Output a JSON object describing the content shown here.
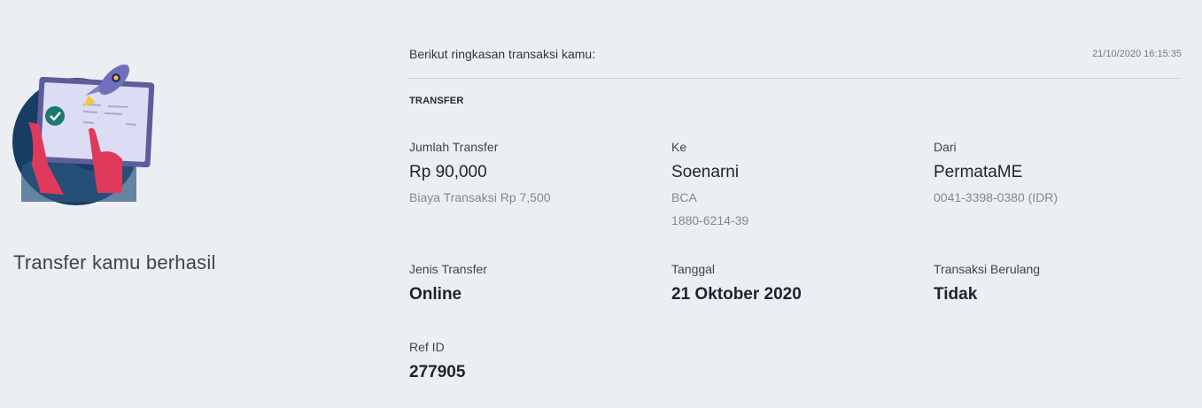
{
  "status": {
    "title": "Transfer kamu berhasil"
  },
  "summary": {
    "intro": "Berikut ringkasan transaksi kamu:",
    "timestamp": "21/10/2020 16:15:35"
  },
  "section": {
    "label": "TRANSFER"
  },
  "fields": {
    "amount": {
      "label": "Jumlah Transfer",
      "value": "Rp 90,000",
      "fee": "Biaya Transaksi Rp 7,500"
    },
    "to": {
      "label": "Ke",
      "value": "Soenarni",
      "bank": "BCA",
      "account": "1880-6214-39"
    },
    "from": {
      "label": "Dari",
      "value": "PermataME",
      "account": "0041-3398-0380 (IDR)"
    },
    "type": {
      "label": "Jenis Transfer",
      "value": "Online"
    },
    "date": {
      "label": "Tanggal",
      "value": "21 Oktober 2020"
    },
    "recurring": {
      "label": "Transaksi Berulang",
      "value": "Tidak"
    },
    "ref": {
      "label": "Ref ID",
      "value": "277905"
    }
  }
}
